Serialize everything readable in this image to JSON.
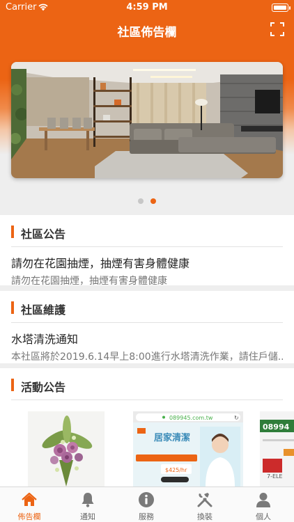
{
  "status_bar": {
    "carrier": "Carrier",
    "time": "4:59 PM"
  },
  "nav": {
    "title": "社區佈告欄",
    "scan_icon": "scan-icon"
  },
  "banner": {
    "page_count": 2,
    "active_page": 2
  },
  "colors": {
    "accent": "#ec6414",
    "text": "#222222",
    "muted": "#777777"
  },
  "announcements": {
    "title": "社區公告",
    "items": [
      {
        "title": "請勿在花園抽煙，抽煙有害身體健康",
        "desc": "請勿在花園抽煙，抽煙有害身體健康"
      }
    ]
  },
  "maintenance": {
    "title": "社區維護",
    "items": [
      {
        "title": "水塔清洗通知",
        "desc": "本社區將於2019.6.14早上8:00進行水塔清洗作業，請住戶儲..."
      }
    ]
  },
  "events": {
    "title": "活動公告",
    "cards": [
      {
        "type": "flowers"
      },
      {
        "type": "ad",
        "url": "089945.com.tw",
        "headline": "居家清潔",
        "price": "$425/hr"
      },
      {
        "type": "ad-partial",
        "brand": "08994",
        "tag": "7-ELE"
      }
    ]
  },
  "tabs": [
    {
      "label": "佈告欄",
      "icon": "home-icon",
      "active": true
    },
    {
      "label": "通知",
      "icon": "bell-icon",
      "active": false
    },
    {
      "label": "服務",
      "icon": "info-icon",
      "active": false
    },
    {
      "label": "換裝",
      "icon": "tools-icon",
      "active": false
    },
    {
      "label": "個人",
      "icon": "person-icon",
      "active": false
    }
  ]
}
